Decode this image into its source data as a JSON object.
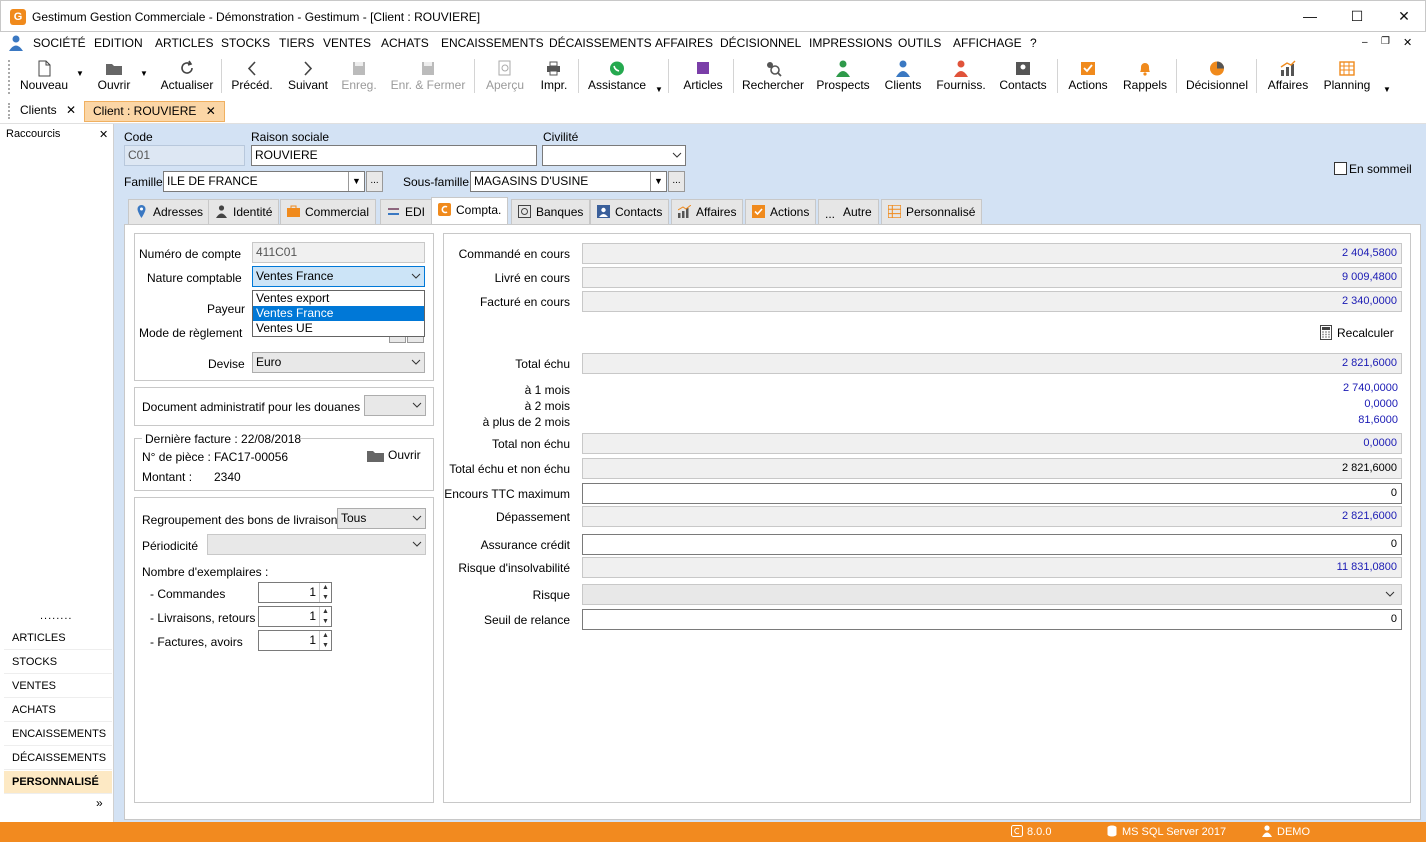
{
  "window": {
    "title": "Gestimum Gestion Commerciale - Démonstration - Gestimum - [Client : ROUVIERE]",
    "app_icon_letter": "G"
  },
  "menu": [
    "SOCIÉTÉ",
    "EDITION",
    "ARTICLES",
    "STOCKS",
    "TIERS",
    "VENTES",
    "ACHATS",
    "ENCAISSEMENTS",
    "DÉCAISSEMENTS",
    "AFFAIRES",
    "DÉCISIONNEL",
    "IMPRESSIONS",
    "OUTILS",
    "AFFICHAGE",
    "?"
  ],
  "toolbar": {
    "nouveau": "Nouveau",
    "ouvrir": "Ouvrir",
    "actualiser": "Actualiser",
    "preced": "Précéd.",
    "suivant": "Suivant",
    "enreg": "Enreg.",
    "enr_fermer": "Enr. & Fermer",
    "apercu": "Aperçu",
    "impr": "Impr.",
    "assistance": "Assistance",
    "articles": "Articles",
    "rechercher": "Rechercher",
    "prospects": "Prospects",
    "clients": "Clients",
    "fourniss": "Fourniss.",
    "contacts": "Contacts",
    "actions": "Actions",
    "rappels": "Rappels",
    "decisionnel": "Décisionnel",
    "affaires": "Affaires",
    "planning": "Planning"
  },
  "doc_tabs": {
    "clients": "Clients",
    "client": "Client : ROUVIERE"
  },
  "left_panel": {
    "title": "Raccourcis",
    "dots": "........",
    "items": [
      "ARTICLES",
      "STOCKS",
      "VENTES",
      "ACHATS",
      "ENCAISSEMENTS",
      "DÉCAISSEMENTS",
      "PERSONNALISÉ"
    ],
    "more": "»"
  },
  "header": {
    "code_label": "Code",
    "code_value": "C01",
    "raison_label": "Raison sociale",
    "raison_value": "ROUVIERE",
    "civilite_label": "Civilité",
    "civilite_value": "",
    "famille_label": "Famille",
    "famille_value": "ILE DE FRANCE",
    "sousfamille_label": "Sous-famille",
    "sousfamille_value": "MAGASINS D'USINE",
    "sommeil_label": "En sommeil",
    "ellipsis": "..."
  },
  "tabs": [
    "Adresses",
    "Identité",
    "Commercial",
    "EDI",
    "Compta.",
    "Banques",
    "Contacts",
    "Affaires",
    "Actions",
    "Autre",
    "Personnalisé"
  ],
  "compta": {
    "numero_label": "Numéro de compte",
    "numero_value": "411C01",
    "nature_label": "Nature comptable",
    "nature_value": "Ventes France",
    "nature_options": [
      "Ventes export",
      "Ventes France",
      "Ventes UE"
    ],
    "payeur_label": "Payeur",
    "reglement_label": "Mode de règlement",
    "devise_label": "Devise",
    "devise_value": "Euro",
    "douanes_label": "Document administratif pour les douanes",
    "derniere_facture": "Dernière facture : 22/08/2018",
    "piece_label": "N° de pièce :",
    "piece_value": "FAC17-00056",
    "montant_label": "Montant :",
    "montant_value": "2340",
    "ouvrir_label": "Ouvrir",
    "regroupement_label": "Regroupement des bons de livraison",
    "regroupement_value": "Tous",
    "periodicite_label": "Périodicité",
    "exemplaires_label": "Nombre d'exemplaires :",
    "commandes_label": "- Commandes",
    "commandes_value": "1",
    "livraisons_label": "- Livraisons, retours",
    "livraisons_value": "1",
    "factures_label": "- Factures, avoirs",
    "factures_value": "1"
  },
  "encours": {
    "commande_label": "Commandé en cours",
    "commande_value": "2 404,5800",
    "livre_label": "Livré en cours",
    "livre_value": "9 009,4800",
    "facture_label": "Facturé en cours",
    "facture_value": "2 340,0000",
    "recalculer": "Recalculer",
    "total_echu_label": "Total échu",
    "total_echu_value": "2 821,6000",
    "un_mois_label": "à 1 mois",
    "un_mois_value": "2 740,0000",
    "deux_mois_label": "à 2 mois",
    "deux_mois_value": "0,0000",
    "plus_deux_label": "à plus de 2 mois",
    "plus_deux_value": "81,6000",
    "non_echu_label": "Total non échu",
    "non_echu_value": "0,0000",
    "echu_non_echu_label": "Total échu et non échu",
    "echu_non_echu_value": "2 821,6000",
    "encours_max_label": "Encours TTC maximum",
    "encours_max_value": "0",
    "depassement_label": "Dépassement",
    "depassement_value": "2 821,6000",
    "assurance_label": "Assurance crédit",
    "assurance_value": "0",
    "risque_insolv_label": "Risque d'insolvabilité",
    "risque_insolv_value": "11 831,0800",
    "risque_label": "Risque",
    "risque_value": "",
    "seuil_label": "Seuil de relance",
    "seuil_value": "0"
  },
  "status": {
    "version": "8.0.0",
    "server": "MS SQL Server 2017",
    "user": "DEMO"
  }
}
